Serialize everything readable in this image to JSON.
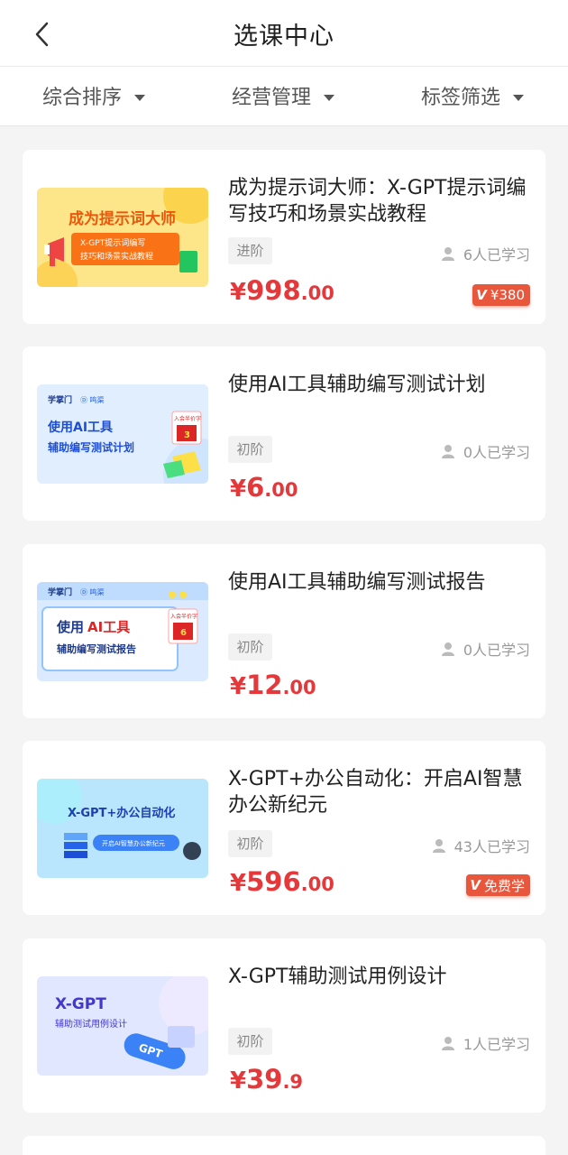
{
  "header": {
    "title": "选课中心",
    "back_icon": "chevron-left-icon"
  },
  "filters": [
    {
      "label": "综合排序"
    },
    {
      "label": "经营管理"
    },
    {
      "label": "标签筛选"
    }
  ],
  "colors": {
    "price": "#e5383b",
    "badge": "#e8563c",
    "level_bg": "#f2f2f2"
  },
  "courses": [
    {
      "title": "成为提示词大师：X-GPT提示词编写技巧和场景实战教程",
      "level": "进阶",
      "learners": "6人已学习",
      "price_symbol": "¥",
      "price_int": "998",
      "price_dec": ".00",
      "badge": {
        "mark": "V",
        "text": "¥380"
      },
      "thumb": {
        "line1": "成为提示词大师",
        "line2": "X-GPT提示词编写",
        "line3": "技巧和场景实战教程"
      }
    },
    {
      "title": "使用AI工具辅助编写测试计划",
      "level": "初阶",
      "learners": "0人已学习",
      "price_symbol": "¥",
      "price_int": "6",
      "price_dec": ".00",
      "thumb": {
        "brand": "学掌门",
        "brand2": "Ⓓ 鸣渠",
        "line1": "使用AI工具",
        "line2": "辅助编写测试计划",
        "tag": "入会半价字",
        "num": "3"
      }
    },
    {
      "title": "使用AI工具辅助编写测试报告",
      "level": "初阶",
      "learners": "0人已学习",
      "price_symbol": "¥",
      "price_int": "12",
      "price_dec": ".00",
      "thumb": {
        "brand": "学掌门",
        "brand2": "Ⓓ 鸣渠",
        "line1a": "使用",
        "line1b": "AI工具",
        "line2": "辅助编写测试报告",
        "tag": "入会半价字",
        "num": "6"
      }
    },
    {
      "title": "X-GPT+办公自动化：开启AI智慧办公新纪元",
      "level": "初阶",
      "learners": "43人已学习",
      "price_symbol": "¥",
      "price_int": "596",
      "price_dec": ".00",
      "badge": {
        "mark": "V",
        "text": "免费学"
      },
      "thumb": {
        "line1": "X-GPT+办公自动化",
        "line2": "开启AI智慧办公新纪元"
      }
    },
    {
      "title": "X-GPT辅助测试用例设计",
      "level": "初阶",
      "learners": "1人已学习",
      "price_symbol": "¥",
      "price_int": "39",
      "price_dec": ".9",
      "thumb": {
        "line1": "X-GPT",
        "line2": "辅助测试用例设计",
        "chip": "GPT"
      }
    }
  ]
}
